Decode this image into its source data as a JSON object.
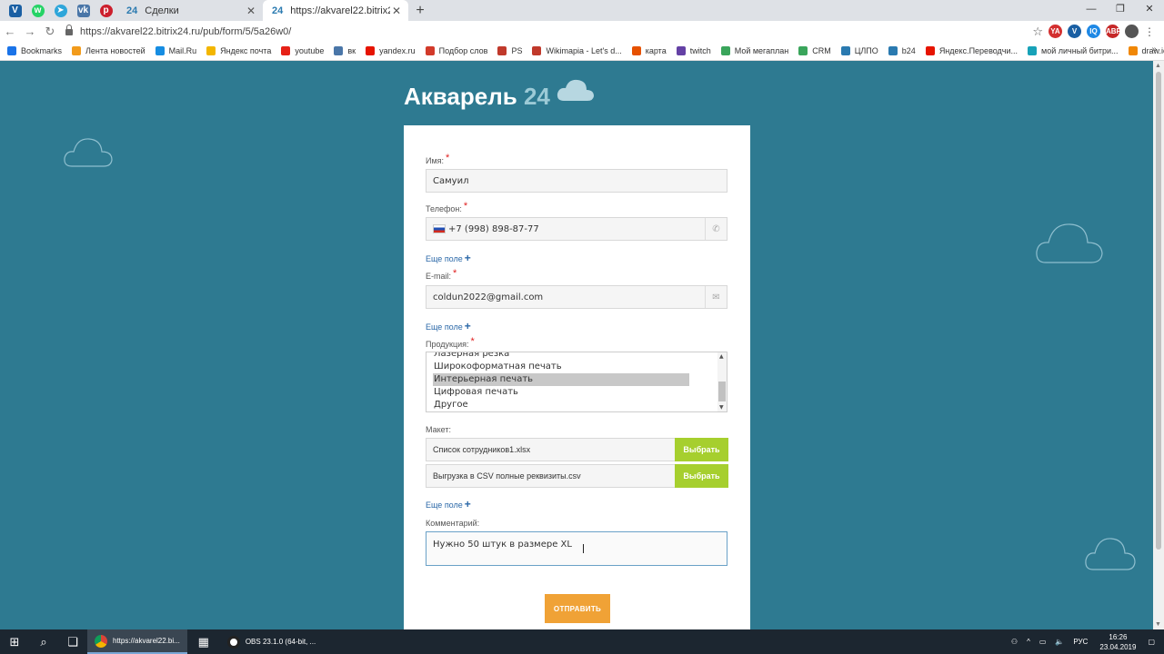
{
  "browser": {
    "tabs": [
      {
        "favicon": "24",
        "title": "Сделки",
        "active": false
      },
      {
        "favicon": "24",
        "title": "https://akvarel22.bitrix24.ru/pub",
        "active": true
      }
    ],
    "url": "https://akvarel22.bitrix24.ru/pub/form/5/5a26w0/",
    "bookmarks": [
      {
        "label": "Bookmarks",
        "color": "#1a73e8"
      },
      {
        "label": "Лента новостей",
        "color": "#f29b1b"
      },
      {
        "label": "Mail.Ru",
        "color": "#168de2"
      },
      {
        "label": "Яндекс почта",
        "color": "#f3b600"
      },
      {
        "label": "youtube",
        "color": "#e62117"
      },
      {
        "label": "вк",
        "color": "#4a76a8"
      },
      {
        "label": "yandex.ru",
        "color": "#e61400"
      },
      {
        "label": "Подбор слов",
        "color": "#d23a2a"
      },
      {
        "label": "PS",
        "color": "#c0392b"
      },
      {
        "label": "Wikimapia - Let's d...",
        "color": "#c0392b"
      },
      {
        "label": "карта",
        "color": "#e65100"
      },
      {
        "label": "twitch",
        "color": "#6441a5"
      },
      {
        "label": "Мой мегаплан",
        "color": "#3aa55b"
      },
      {
        "label": "CRM",
        "color": "#3aa55b"
      },
      {
        "label": "ЦЛПО",
        "color": "#2a7ab0"
      },
      {
        "label": "b24",
        "color": "#2a7ab0"
      },
      {
        "label": "Яндекс.Переводчи...",
        "color": "#e61400"
      },
      {
        "label": "мой личный битри...",
        "color": "#17a2b8"
      },
      {
        "label": "draw.io",
        "color": "#f08705"
      }
    ]
  },
  "form": {
    "brand_name": "Акварель",
    "brand_num": "24",
    "name_label": "Имя:",
    "name_value": "Самуил",
    "phone_label": "Телефон:",
    "phone_value": "+7 (998) 898-87-77",
    "more_field": "Еще поле",
    "email_label": "E-mail:",
    "email_value": "coldun2022@gmail.com",
    "products_label": "Продукция:",
    "products": [
      "Лазерная резка",
      "Широкоформатная печать",
      "Интерьерная печать",
      "Цифровая печать",
      "Другое"
    ],
    "selected_product": "Интерьерная печать",
    "layout_label": "Макет:",
    "file1": "Список сотрудников1.xlsx",
    "file2": "Выгрузка в CSV полные реквизиты.csv",
    "pick_label": "Выбрать",
    "comment_label": "Комментарий:",
    "comment_value": "Нужно 50 штук в размере XL",
    "submit_label": "ОТПРАВИТЬ"
  },
  "taskbar": {
    "chrome_label": "https://akvarel22.bi...",
    "obs_label": "OBS 23.1.0 (64-bit, ...",
    "lang": "РУС",
    "time": "16:26",
    "date": "23.04.2019"
  }
}
